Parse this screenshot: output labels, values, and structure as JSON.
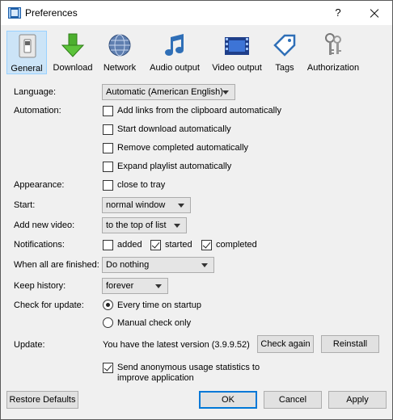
{
  "window": {
    "title": "Preferences",
    "help_label": "?"
  },
  "toolbar": {
    "items": [
      {
        "label": "General",
        "icon": "general-switch-icon",
        "active": true
      },
      {
        "label": "Download",
        "icon": "download-arrow-icon"
      },
      {
        "label": "Network",
        "icon": "globe-icon"
      },
      {
        "label": "Audio output",
        "icon": "music-note-icon"
      },
      {
        "label": "Video output",
        "icon": "film-strip-icon"
      },
      {
        "label": "Tags",
        "icon": "tag-icon"
      },
      {
        "label": "Authorization",
        "icon": "keys-icon"
      }
    ]
  },
  "form": {
    "language": {
      "label": "Language:",
      "value": "Automatic (American English)"
    },
    "automation": {
      "label": "Automation:",
      "options": [
        {
          "label": "Add links from the clipboard automatically",
          "checked": false
        },
        {
          "label": "Start download automatically",
          "checked": false
        },
        {
          "label": "Remove completed automatically",
          "checked": false
        },
        {
          "label": "Expand playlist automatically",
          "checked": false
        }
      ]
    },
    "appearance": {
      "label": "Appearance:",
      "option": "close to tray",
      "checked": false
    },
    "start": {
      "label": "Start:",
      "value": "normal window"
    },
    "add_new_video": {
      "label": "Add new video:",
      "value": "to the top of list"
    },
    "notifications": {
      "label": "Notifications:",
      "options": [
        {
          "label": "added",
          "checked": false
        },
        {
          "label": "started",
          "checked": true
        },
        {
          "label": "completed",
          "checked": true
        }
      ]
    },
    "when_finished": {
      "label": "When all are finished:",
      "value": "Do nothing"
    },
    "keep_history": {
      "label": "Keep history:",
      "value": "forever"
    },
    "check_update": {
      "label": "Check for update:",
      "options": [
        {
          "label": "Every time on startup",
          "selected": true
        },
        {
          "label": "Manual check only",
          "selected": false
        }
      ]
    },
    "update": {
      "label": "Update:",
      "status": "You have the latest version (3.9.9.52)",
      "check_again": "Check again",
      "reinstall": "Reinstall"
    },
    "statistics": {
      "label": "Send anonymous usage statistics to improve application",
      "line1": "Send anonymous usage statistics to",
      "line2": "improve application",
      "checked": true
    }
  },
  "footer": {
    "restore": "Restore Defaults",
    "ok": "OK",
    "cancel": "Cancel",
    "apply": "Apply"
  },
  "colors": {
    "accent": "#0078d7",
    "selection": "#cce4f7"
  }
}
